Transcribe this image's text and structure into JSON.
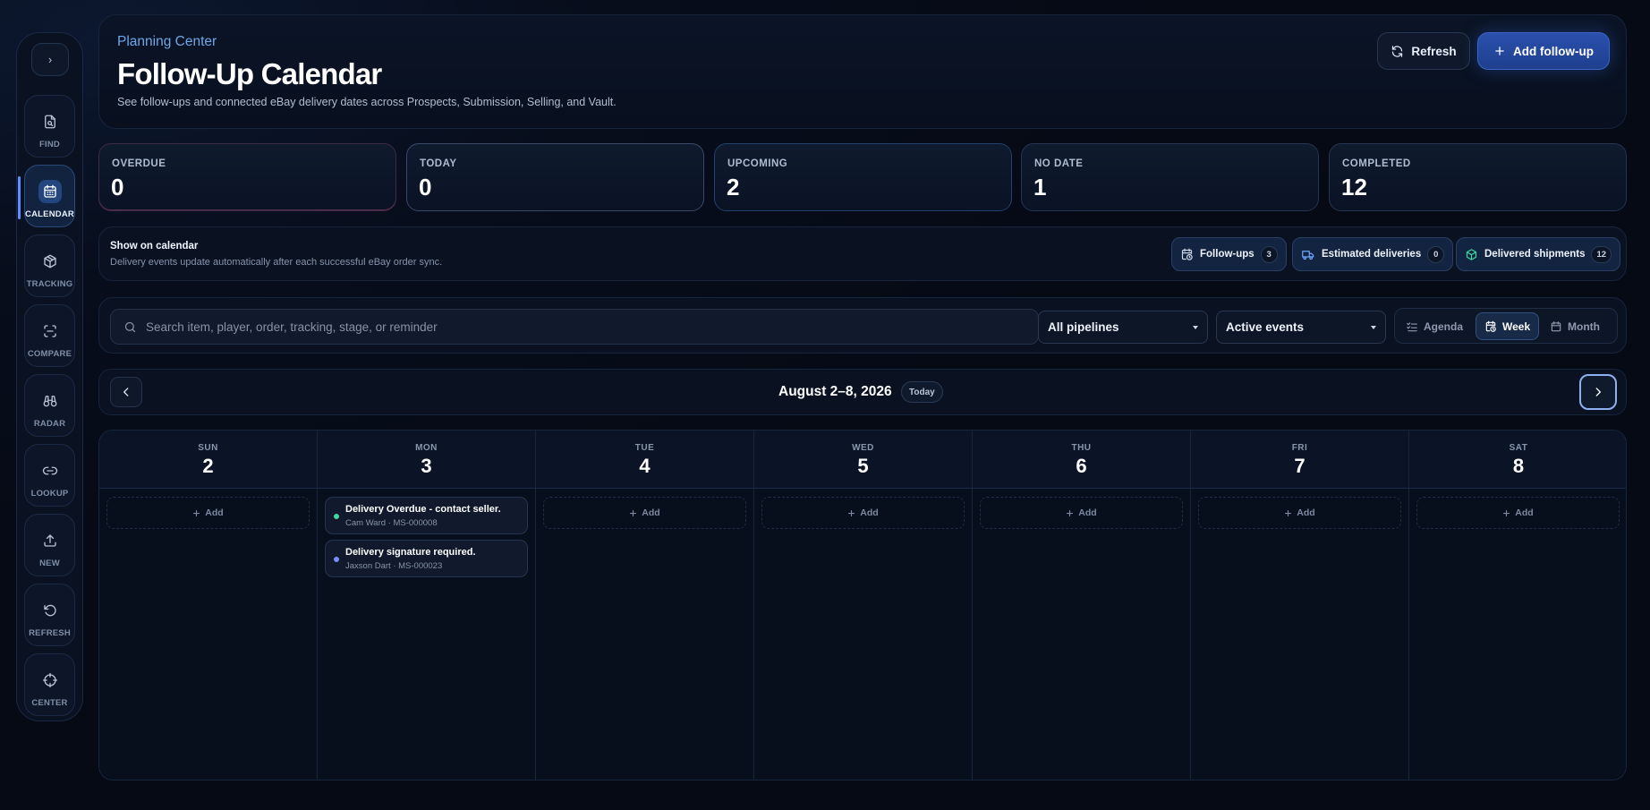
{
  "rail": {
    "toggle": "›",
    "items": [
      {
        "label": "FIND",
        "icon": "file-search-icon"
      },
      {
        "label": "CALENDAR",
        "icon": "calendar-icon"
      },
      {
        "label": "TRACKING",
        "icon": "package-icon"
      },
      {
        "label": "COMPARE",
        "icon": "scan-icon"
      },
      {
        "label": "RADAR",
        "icon": "binoculars-icon"
      },
      {
        "label": "LOOKUP",
        "icon": "link-icon"
      },
      {
        "label": "NEW",
        "icon": "upload-icon"
      },
      {
        "label": "REFRESH",
        "icon": "rotate-ccw-icon"
      },
      {
        "label": "CENTER",
        "icon": "crosshair-icon"
      }
    ]
  },
  "header": {
    "kicker": "Planning Center",
    "title": "Follow-Up Calendar",
    "subtitle": "See follow-ups and connected eBay delivery dates across Prospects, Submission, Selling, and Vault.",
    "refresh_label": "Refresh",
    "add_label": "Add follow-up"
  },
  "stats": [
    {
      "label": "OVERDUE",
      "value": "0"
    },
    {
      "label": "TODAY",
      "value": "0"
    },
    {
      "label": "UPCOMING",
      "value": "2"
    },
    {
      "label": "NO DATE",
      "value": "1"
    },
    {
      "label": "COMPLETED",
      "value": "12"
    }
  ],
  "show_on_calendar": {
    "title": "Show on calendar",
    "subtitle": "Delivery events update automatically after each successful eBay order sync.",
    "chips": [
      {
        "label": "Follow-ups",
        "count": "3",
        "icon": "calendar-clock-icon",
        "color": "#cfd8ea"
      },
      {
        "label": "Estimated deliveries",
        "count": "0",
        "icon": "truck-icon",
        "color": "#6ea8ff"
      },
      {
        "label": "Delivered shipments",
        "count": "12",
        "icon": "package-check-icon",
        "color": "#3ed6a0"
      }
    ]
  },
  "filters": {
    "search_placeholder": "Search item, player, order, tracking, stage, or reminder",
    "pipeline": "All pipelines",
    "status": "Active events",
    "views": [
      "Agenda",
      "Week",
      "Month"
    ],
    "active_view": "Week"
  },
  "nav": {
    "range": "August 2–8, 2026",
    "today": "Today"
  },
  "week": {
    "days": [
      {
        "dow": "SUN",
        "date": "2"
      },
      {
        "dow": "MON",
        "date": "3"
      },
      {
        "dow": "TUE",
        "date": "4"
      },
      {
        "dow": "WED",
        "date": "5"
      },
      {
        "dow": "THU",
        "date": "6"
      },
      {
        "dow": "FRI",
        "date": "7"
      },
      {
        "dow": "SAT",
        "date": "8"
      }
    ],
    "add_label": "Add",
    "events": [
      {
        "title": "Delivery Overdue - contact seller.",
        "meta": "Cam Ward · MS-000008",
        "dot_color": "#3ed6a0"
      },
      {
        "title": "Delivery signature required.",
        "meta": "Jaxson Dart · MS-000023",
        "dot_color": "#7c8cff"
      }
    ]
  },
  "colors": {
    "accent": "#2a50ad",
    "background": "#060b17"
  }
}
